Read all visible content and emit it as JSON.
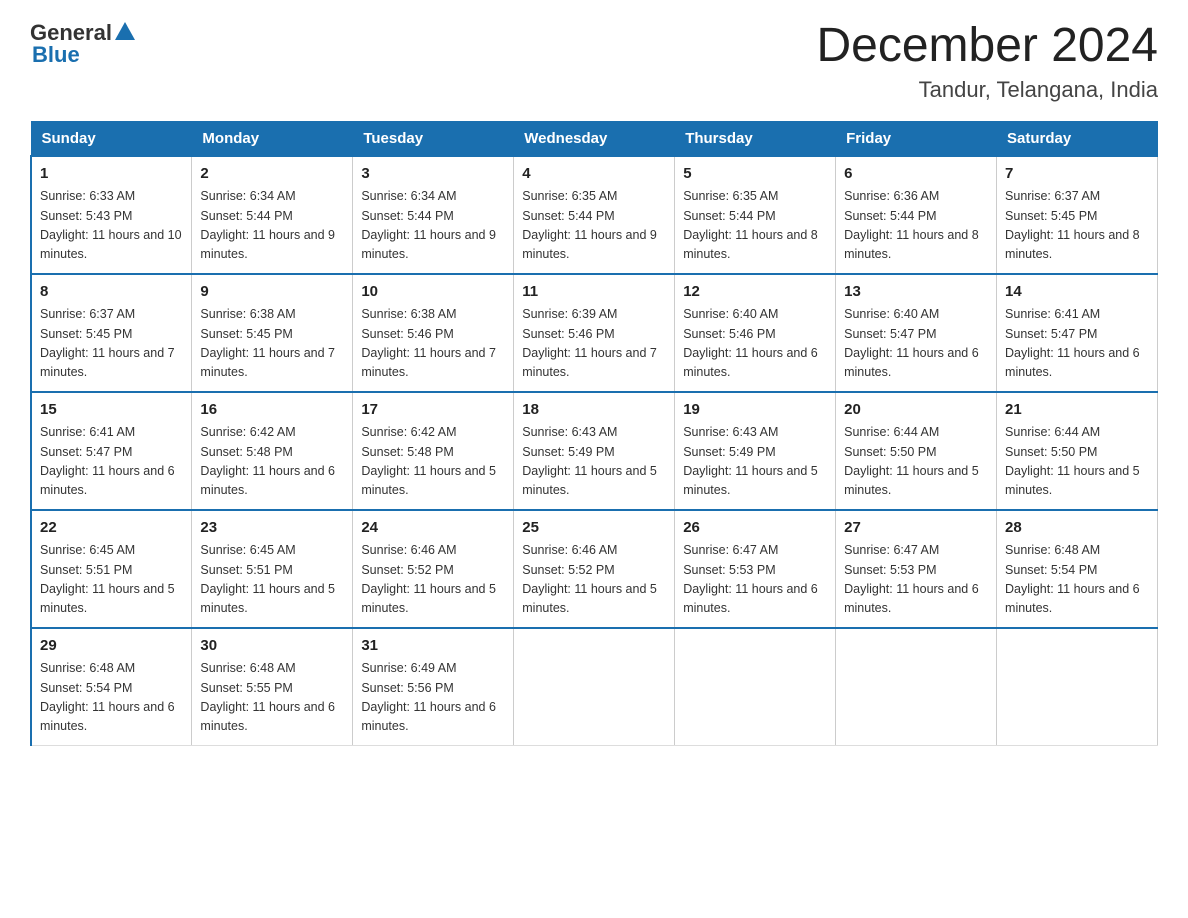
{
  "header": {
    "logo_general": "General",
    "logo_blue": "Blue",
    "month_title": "December 2024",
    "location": "Tandur, Telangana, India"
  },
  "weekdays": [
    "Sunday",
    "Monday",
    "Tuesday",
    "Wednesday",
    "Thursday",
    "Friday",
    "Saturday"
  ],
  "weeks": [
    [
      {
        "day": "1",
        "sunrise": "6:33 AM",
        "sunset": "5:43 PM",
        "daylight": "11 hours and 10 minutes."
      },
      {
        "day": "2",
        "sunrise": "6:34 AM",
        "sunset": "5:44 PM",
        "daylight": "11 hours and 9 minutes."
      },
      {
        "day": "3",
        "sunrise": "6:34 AM",
        "sunset": "5:44 PM",
        "daylight": "11 hours and 9 minutes."
      },
      {
        "day": "4",
        "sunrise": "6:35 AM",
        "sunset": "5:44 PM",
        "daylight": "11 hours and 9 minutes."
      },
      {
        "day": "5",
        "sunrise": "6:35 AM",
        "sunset": "5:44 PM",
        "daylight": "11 hours and 8 minutes."
      },
      {
        "day": "6",
        "sunrise": "6:36 AM",
        "sunset": "5:44 PM",
        "daylight": "11 hours and 8 minutes."
      },
      {
        "day": "7",
        "sunrise": "6:37 AM",
        "sunset": "5:45 PM",
        "daylight": "11 hours and 8 minutes."
      }
    ],
    [
      {
        "day": "8",
        "sunrise": "6:37 AM",
        "sunset": "5:45 PM",
        "daylight": "11 hours and 7 minutes."
      },
      {
        "day": "9",
        "sunrise": "6:38 AM",
        "sunset": "5:45 PM",
        "daylight": "11 hours and 7 minutes."
      },
      {
        "day": "10",
        "sunrise": "6:38 AM",
        "sunset": "5:46 PM",
        "daylight": "11 hours and 7 minutes."
      },
      {
        "day": "11",
        "sunrise": "6:39 AM",
        "sunset": "5:46 PM",
        "daylight": "11 hours and 7 minutes."
      },
      {
        "day": "12",
        "sunrise": "6:40 AM",
        "sunset": "5:46 PM",
        "daylight": "11 hours and 6 minutes."
      },
      {
        "day": "13",
        "sunrise": "6:40 AM",
        "sunset": "5:47 PM",
        "daylight": "11 hours and 6 minutes."
      },
      {
        "day": "14",
        "sunrise": "6:41 AM",
        "sunset": "5:47 PM",
        "daylight": "11 hours and 6 minutes."
      }
    ],
    [
      {
        "day": "15",
        "sunrise": "6:41 AM",
        "sunset": "5:47 PM",
        "daylight": "11 hours and 6 minutes."
      },
      {
        "day": "16",
        "sunrise": "6:42 AM",
        "sunset": "5:48 PM",
        "daylight": "11 hours and 6 minutes."
      },
      {
        "day": "17",
        "sunrise": "6:42 AM",
        "sunset": "5:48 PM",
        "daylight": "11 hours and 5 minutes."
      },
      {
        "day": "18",
        "sunrise": "6:43 AM",
        "sunset": "5:49 PM",
        "daylight": "11 hours and 5 minutes."
      },
      {
        "day": "19",
        "sunrise": "6:43 AM",
        "sunset": "5:49 PM",
        "daylight": "11 hours and 5 minutes."
      },
      {
        "day": "20",
        "sunrise": "6:44 AM",
        "sunset": "5:50 PM",
        "daylight": "11 hours and 5 minutes."
      },
      {
        "day": "21",
        "sunrise": "6:44 AM",
        "sunset": "5:50 PM",
        "daylight": "11 hours and 5 minutes."
      }
    ],
    [
      {
        "day": "22",
        "sunrise": "6:45 AM",
        "sunset": "5:51 PM",
        "daylight": "11 hours and 5 minutes."
      },
      {
        "day": "23",
        "sunrise": "6:45 AM",
        "sunset": "5:51 PM",
        "daylight": "11 hours and 5 minutes."
      },
      {
        "day": "24",
        "sunrise": "6:46 AM",
        "sunset": "5:52 PM",
        "daylight": "11 hours and 5 minutes."
      },
      {
        "day": "25",
        "sunrise": "6:46 AM",
        "sunset": "5:52 PM",
        "daylight": "11 hours and 5 minutes."
      },
      {
        "day": "26",
        "sunrise": "6:47 AM",
        "sunset": "5:53 PM",
        "daylight": "11 hours and 6 minutes."
      },
      {
        "day": "27",
        "sunrise": "6:47 AM",
        "sunset": "5:53 PM",
        "daylight": "11 hours and 6 minutes."
      },
      {
        "day": "28",
        "sunrise": "6:48 AM",
        "sunset": "5:54 PM",
        "daylight": "11 hours and 6 minutes."
      }
    ],
    [
      {
        "day": "29",
        "sunrise": "6:48 AM",
        "sunset": "5:54 PM",
        "daylight": "11 hours and 6 minutes."
      },
      {
        "day": "30",
        "sunrise": "6:48 AM",
        "sunset": "5:55 PM",
        "daylight": "11 hours and 6 minutes."
      },
      {
        "day": "31",
        "sunrise": "6:49 AM",
        "sunset": "5:56 PM",
        "daylight": "11 hours and 6 minutes."
      },
      {
        "day": "",
        "sunrise": "",
        "sunset": "",
        "daylight": ""
      },
      {
        "day": "",
        "sunrise": "",
        "sunset": "",
        "daylight": ""
      },
      {
        "day": "",
        "sunrise": "",
        "sunset": "",
        "daylight": ""
      },
      {
        "day": "",
        "sunrise": "",
        "sunset": "",
        "daylight": ""
      }
    ]
  ],
  "labels": {
    "sunrise": "Sunrise: ",
    "sunset": "Sunset: ",
    "daylight": "Daylight: "
  }
}
